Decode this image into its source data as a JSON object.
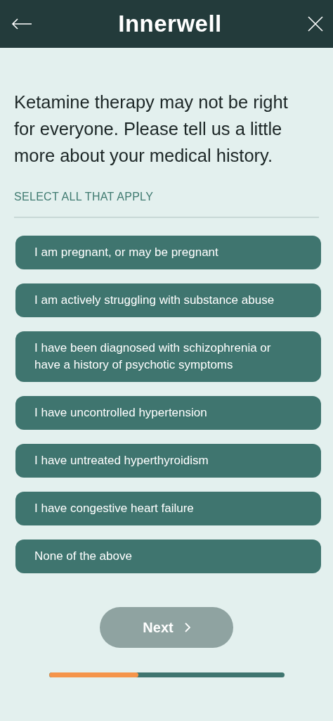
{
  "header": {
    "logo": "Innerwell"
  },
  "question": "Ketamine therapy may not be right for everyone. Please tell us a little more about your medical history.",
  "instruction": "SELECT ALL THAT APPLY",
  "options": [
    {
      "label": "I am pregnant, or may be pregnant",
      "selected": false
    },
    {
      "label": "I am actively struggling with substance abuse",
      "selected": false
    },
    {
      "label": "I have been diagnosed with schizophrenia or have a history of psychotic symptoms",
      "selected": false
    },
    {
      "label": "I have uncontrolled hypertension",
      "selected": false
    },
    {
      "label": "I have untreated hyperthyroidism",
      "selected": false
    },
    {
      "label": "I have congestive heart failure",
      "selected": false
    },
    {
      "label": "None of the above",
      "selected": false
    }
  ],
  "next_button": {
    "label": "Next",
    "disabled": true
  },
  "progress": {
    "level": 0.38
  }
}
